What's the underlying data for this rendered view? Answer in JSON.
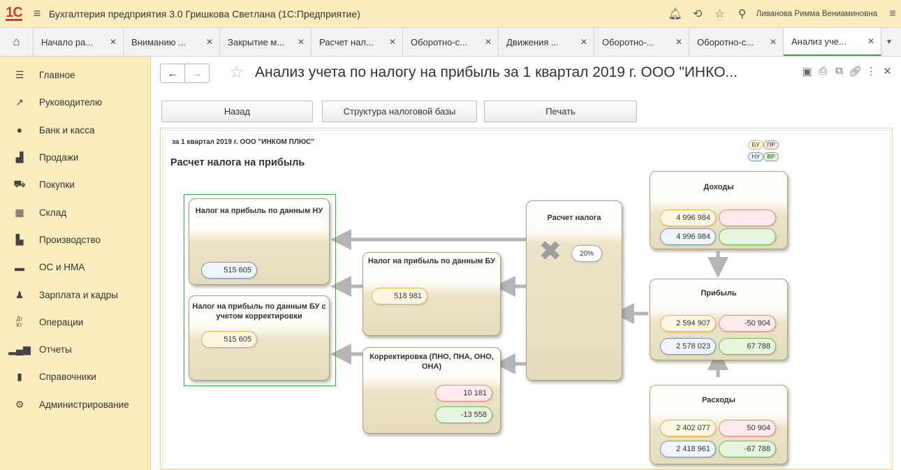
{
  "app": {
    "title": "Бухгалтерия предприятия 3.0 Гришкова Светлана  (1С:Предприятие)",
    "user": "Ливанова Римма Вениаминовна"
  },
  "tabs": [
    {
      "label": "Начало ра...",
      "active": false
    },
    {
      "label": "Вниманию ...",
      "active": false
    },
    {
      "label": "Закрытие м...",
      "active": false
    },
    {
      "label": "Расчет нал...",
      "active": false
    },
    {
      "label": "Оборотно-с...",
      "active": false
    },
    {
      "label": "Движения ...",
      "active": false
    },
    {
      "label": "Оборотно-...",
      "active": false
    },
    {
      "label": "Оборотно-с...",
      "active": false
    },
    {
      "label": "Анализ уче...",
      "active": true
    }
  ],
  "sidebar": {
    "items": [
      {
        "label": "Главное",
        "icon": "menu-lines-icon"
      },
      {
        "label": "Руководителю",
        "icon": "trend-icon"
      },
      {
        "label": "Банк и касса",
        "icon": "coin-icon"
      },
      {
        "label": "Продажи",
        "icon": "shopping-bag-icon"
      },
      {
        "label": "Покупки",
        "icon": "cart-icon"
      },
      {
        "label": "Склад",
        "icon": "warehouse-icon"
      },
      {
        "label": "Производство",
        "icon": "factory-icon"
      },
      {
        "label": "ОС и НМА",
        "icon": "truck-icon"
      },
      {
        "label": "Зарплата и кадры",
        "icon": "person-icon"
      },
      {
        "label": "Операции",
        "icon": "dt-kt-icon"
      },
      {
        "label": "Отчеты",
        "icon": "bar-chart-icon"
      },
      {
        "label": "Справочники",
        "icon": "book-icon"
      },
      {
        "label": "Администрирование",
        "icon": "gear-icon"
      }
    ]
  },
  "document": {
    "title": "Анализ учета по налогу на прибыль за 1 квартал 2019 г. ООО \"ИНКО...",
    "buttons": {
      "back": "Назад",
      "structure": "Структура налоговой базы",
      "print": "Печать"
    }
  },
  "report": {
    "period": "за 1 квартал 2019 г. ООО \"ИНКОМ ПЛЮС\"",
    "title": "Расчет налога на прибыль",
    "legend": {
      "bu": "БУ",
      "pr": "ПР",
      "nu": "НУ",
      "vr": "ВР"
    },
    "colors": {
      "bu": "#f0b54a",
      "nu": "#6e97c4",
      "pr": "#e38a8a",
      "vr": "#72bb5a",
      "frame": "#3aa34a"
    },
    "boxes": {
      "tax_nu": {
        "title": "Налог на прибыль по данным НУ",
        "nu": "515 605"
      },
      "tax_bu_adj": {
        "title": "Налог на прибыль по данным БУ с учетом корректировки",
        "bu": "515 605"
      },
      "tax_bu": {
        "title": "Налог на прибыль по данным БУ",
        "bu": "518 981"
      },
      "adjustment": {
        "title": "Корректировка (ПНО, ПНА, ОНО, ОНА)",
        "pr": "10 181",
        "vr": "-13 558"
      },
      "tax_calc": {
        "title": "Расчет налога",
        "rate": "20%"
      },
      "income": {
        "title": "Доходы",
        "bu": "4 996 984",
        "pr": "",
        "nu": "4 996 984",
        "vr": ""
      },
      "profit": {
        "title": "Прибыль",
        "bu": "2 594 907",
        "pr": "-50 904",
        "nu": "2 578 023",
        "vr": "67 788"
      },
      "expenses": {
        "title": "Расходы",
        "bu": "2 402 077",
        "pr": "50 904",
        "nu": "2 418 961",
        "vr": "-67 788"
      }
    }
  }
}
